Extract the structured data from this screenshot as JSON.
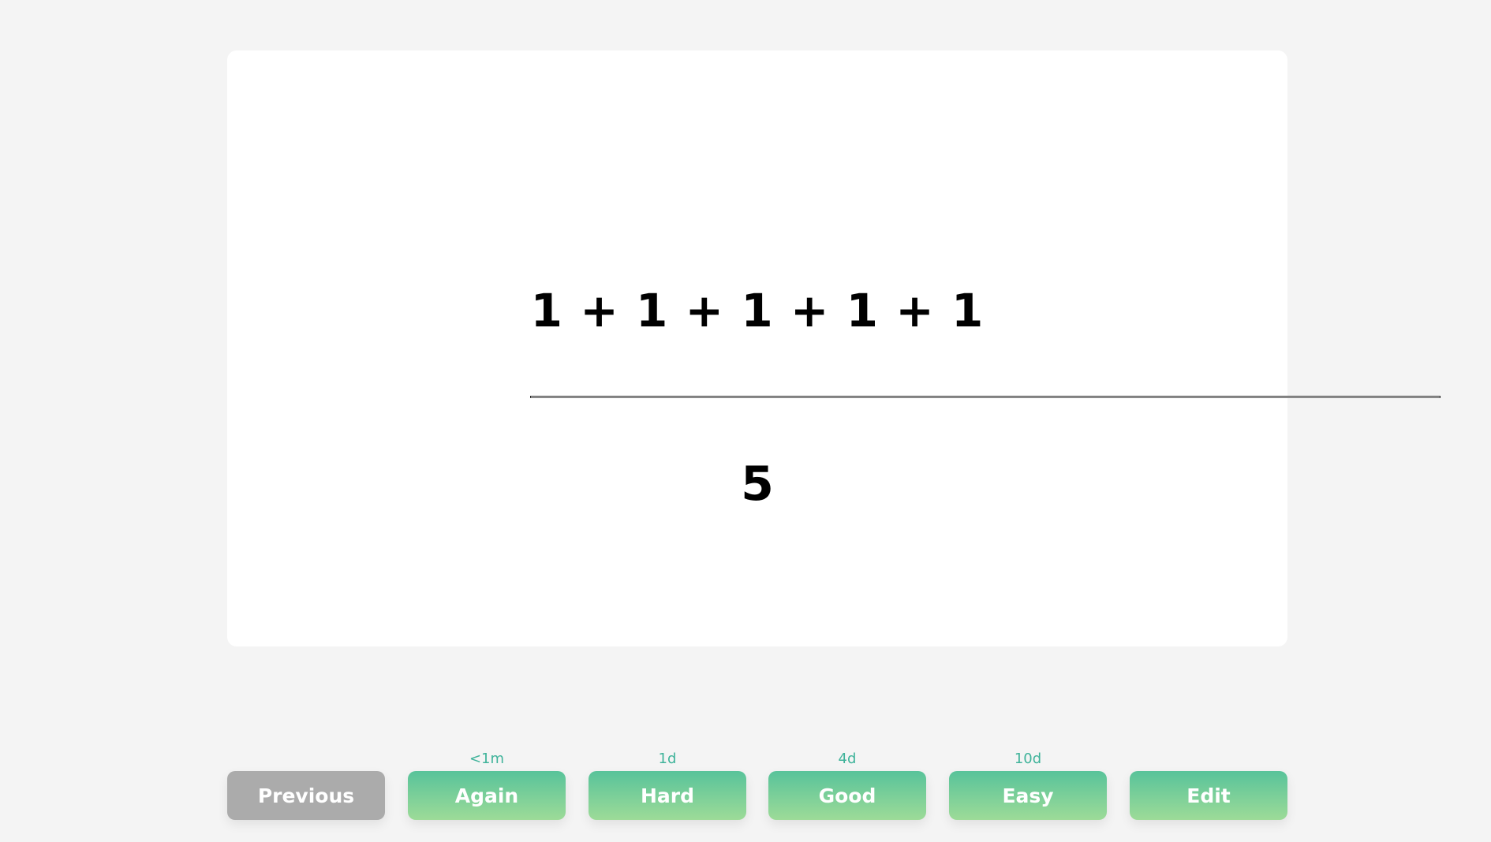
{
  "card": {
    "question": "1 + 1 + 1 + 1 + 1",
    "answer": "5"
  },
  "buttons": {
    "previous": {
      "label": "Previous"
    },
    "again": {
      "label": "Again",
      "interval": "<1m"
    },
    "hard": {
      "label": "Hard",
      "interval": "1d"
    },
    "good": {
      "label": "Good",
      "interval": "4d"
    },
    "easy": {
      "label": "Easy",
      "interval": "10d"
    },
    "edit": {
      "label": "Edit"
    }
  },
  "colors": {
    "background": "#f4f4f4",
    "card": "#ffffff",
    "previous_button": "#ababab",
    "answer_button_top": "#58c39a",
    "answer_button_bottom": "#9ddb98",
    "interval_text": "#3fb39a"
  }
}
